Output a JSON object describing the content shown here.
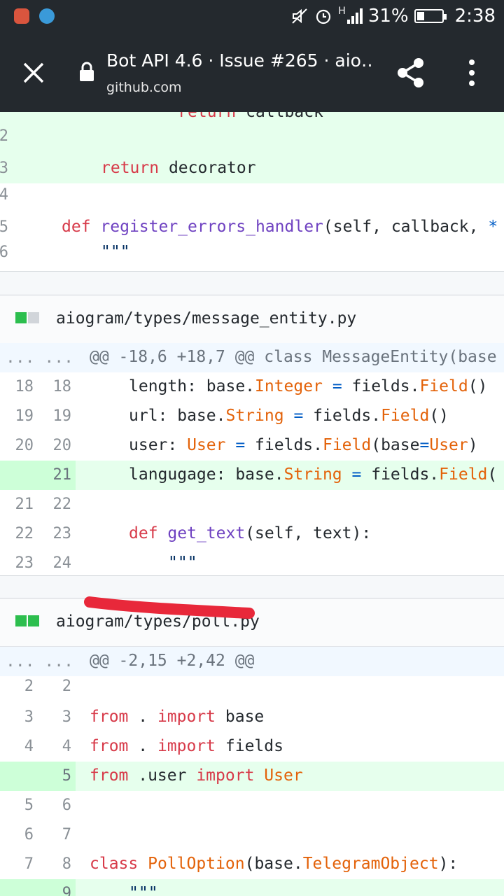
{
  "status_bar": {
    "battery_percent_label": "31%",
    "battery_level": 0.31,
    "time": "2:38",
    "network_label": "H",
    "icons": [
      "mail-app-icon",
      "telegram-icon",
      "mute-icon",
      "alarm-icon",
      "signal-icon",
      "battery-icon"
    ]
  },
  "toolbar": {
    "title": "Bot API 4.6 · Issue #265 · aio…",
    "domain": "github.com",
    "icons": [
      "close-icon",
      "lock-icon",
      "share-icon",
      "more-icon"
    ]
  },
  "colors": {
    "toolbar_bg": "#24292e",
    "added_line_bg": "#e6ffed",
    "keyword": "#d73a49",
    "function": "#6f42c1",
    "type": "#e36209",
    "operator": "#005cc5",
    "markup": "#e8283a"
  },
  "diff_top": {
    "lines": [
      {
        "a": "",
        "b": "",
        "text": "            return callback"
      },
      {
        "a": "",
        "b": "2",
        "text": ""
      },
      {
        "a": "",
        "b": "3",
        "text": "        return decorator"
      },
      {
        "a": "",
        "b": "4",
        "text": ""
      },
      {
        "a": "",
        "b": "5",
        "text": "    def register_errors_handler(self, callback, *"
      },
      {
        "a": "",
        "b": "6",
        "text": "        \"\"\""
      }
    ]
  },
  "file1": {
    "name": "aiogram/types/message_entity.py",
    "hunk_dots": "... ...",
    "hunk": "@@ -18,6 +18,7 @@ class MessageEntity(base",
    "lines": [
      {
        "a": "18",
        "b": "18",
        "text": "    length: base.Integer = fields.Field()"
      },
      {
        "a": "19",
        "b": "19",
        "text": "    url: base.String = fields.Field()"
      },
      {
        "a": "20",
        "b": "20",
        "text": "    user: User = fields.Field(base=User)"
      },
      {
        "a": "",
        "b": "21",
        "text": "    langugage: base.String = fields.Field("
      },
      {
        "a": "21",
        "b": "22",
        "text": ""
      },
      {
        "a": "22",
        "b": "23",
        "text": "    def get_text(self, text):"
      },
      {
        "a": "23",
        "b": "24",
        "text": "        \"\"\""
      }
    ]
  },
  "file2": {
    "name": "aiogram/types/poll.py",
    "hunk_dots": "... ...",
    "hunk": "@@ -2,15 +2,42 @@",
    "lines": [
      {
        "a": "2",
        "b": "2",
        "text": ""
      },
      {
        "a": "3",
        "b": "3",
        "text": "from . import base"
      },
      {
        "a": "4",
        "b": "4",
        "text": "from . import fields"
      },
      {
        "a": "",
        "b": "5",
        "text": "from .user import User"
      },
      {
        "a": "5",
        "b": "6",
        "text": ""
      },
      {
        "a": "6",
        "b": "7",
        "text": ""
      },
      {
        "a": "7",
        "b": "8",
        "text": "class PollOption(base.TelegramObject):"
      },
      {
        "a": "",
        "b": "9",
        "text": "    \"\"\""
      }
    ]
  }
}
